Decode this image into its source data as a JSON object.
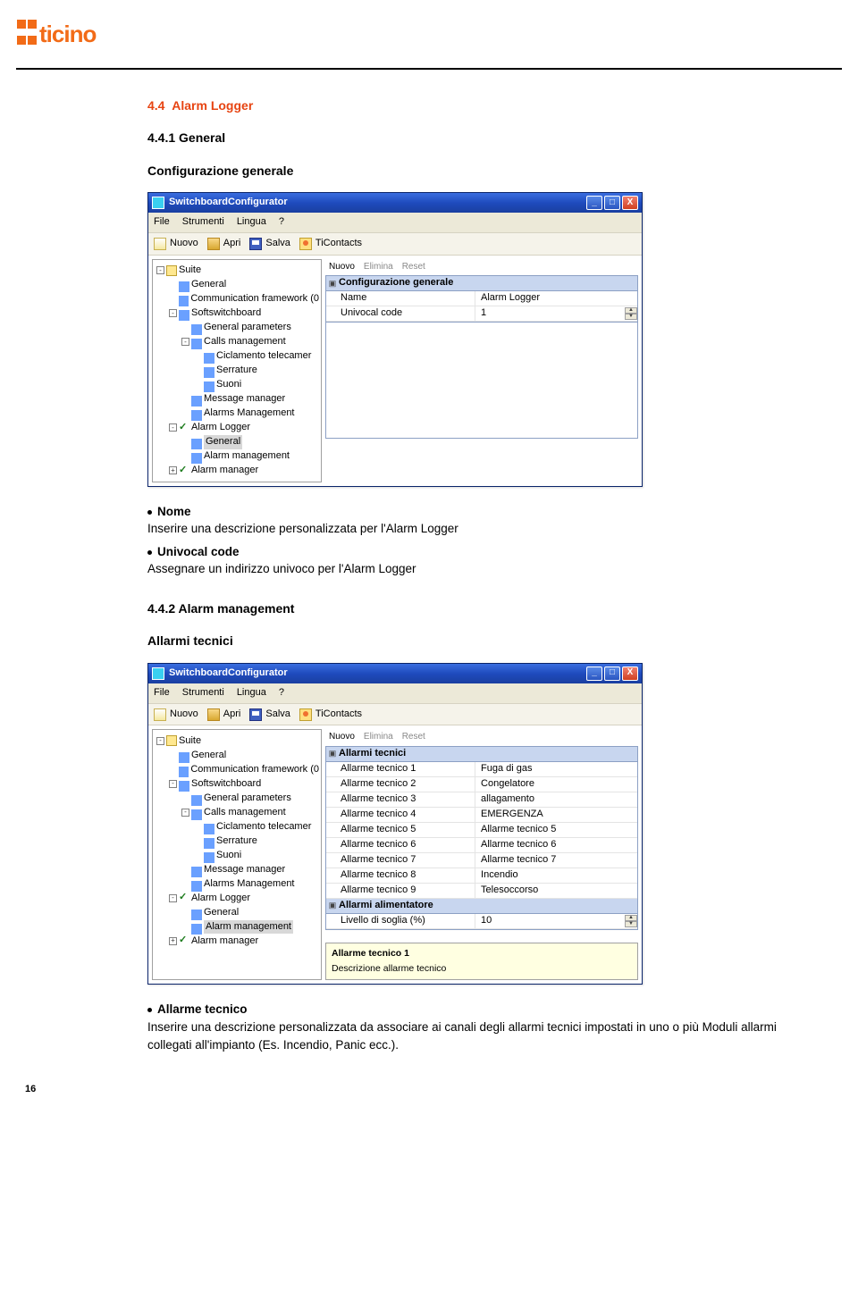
{
  "logo_text": "ticino",
  "section": {
    "num_title": "4.4",
    "title": "Alarm Logger"
  },
  "sub1": {
    "num_title": "4.4.1 General"
  },
  "config_gen_title": "Configurazione generale",
  "bullets1": [
    {
      "label": "Nome",
      "text": "Inserire una descrizione personalizzata per l'Alarm Logger"
    },
    {
      "label": "Univocal code",
      "text": "Assegnare un indirizzo univoco per l'Alarm Logger"
    }
  ],
  "sub2": {
    "num_title": "4.4.2 Alarm management"
  },
  "allarmi_tecnici_title": "Allarmi tecnici",
  "bullets2": [
    {
      "label": "Allarme tecnico",
      "text": "Inserire una descrizione personalizzata da associare ai canali degli allarmi tecnici impostati in uno o più Moduli allarmi collegati all'impianto (Es. Incendio, Panic ecc.)."
    }
  ],
  "page_number": "16",
  "win": {
    "title": "SwitchboardConfigurator",
    "menu": {
      "file": "File",
      "tools": "Strumenti",
      "lang": "Lingua",
      "help": "?"
    },
    "toolbar": {
      "nuovo": "Nuovo",
      "apri": "Apri",
      "salva": "Salva",
      "ticontacts": "TiContacts"
    },
    "tree": {
      "suite": "Suite",
      "general": "General",
      "commfw": "Communication framework (0",
      "softsb": "Softswitchboard",
      "genparams": "General parameters",
      "callsmgmt": "Calls management",
      "ciclamento": "Ciclamento telecamer",
      "serrature": "Serrature",
      "suoni": "Suoni",
      "msgmgr": "Message manager",
      "alarmsmgmt": "Alarms Management",
      "alarmlogger": "Alarm Logger",
      "al_general": "General",
      "al_mgmt": "Alarm management",
      "alarmmanager": "Alarm manager"
    },
    "propactions": {
      "nuovo": "Nuovo",
      "elimina": "Elimina",
      "reset": "Reset"
    }
  },
  "win1": {
    "cat": "Configurazione generale",
    "rows": [
      {
        "k": "Name",
        "v": "Alarm Logger"
      },
      {
        "k": "Univocal code",
        "v": "1",
        "spinner": true
      }
    ],
    "selected": "al_general"
  },
  "win2": {
    "cat1": "Allarmi tecnici",
    "rows": [
      {
        "k": "Allarme tecnico 1",
        "v": "Fuga di gas"
      },
      {
        "k": "Allarme tecnico 2",
        "v": "Congelatore"
      },
      {
        "k": "Allarme tecnico 3",
        "v": "allagamento"
      },
      {
        "k": "Allarme tecnico 4",
        "v": "EMERGENZA"
      },
      {
        "k": "Allarme tecnico 5",
        "v": "Allarme tecnico 5"
      },
      {
        "k": "Allarme tecnico 6",
        "v": "Allarme tecnico 6"
      },
      {
        "k": "Allarme tecnico 7",
        "v": "Allarme tecnico 7"
      },
      {
        "k": "Allarme tecnico 8",
        "v": "Incendio"
      },
      {
        "k": "Allarme tecnico 9",
        "v": "Telesoccorso"
      }
    ],
    "cat2": "Allarmi alimentatore",
    "rows2": [
      {
        "k": "Livello di soglia (%)",
        "v": "10",
        "spinner": true
      }
    ],
    "hint_title": "Allarme tecnico 1",
    "hint_text": "Descrizione allarme tecnico",
    "selected": "al_mgmt"
  }
}
